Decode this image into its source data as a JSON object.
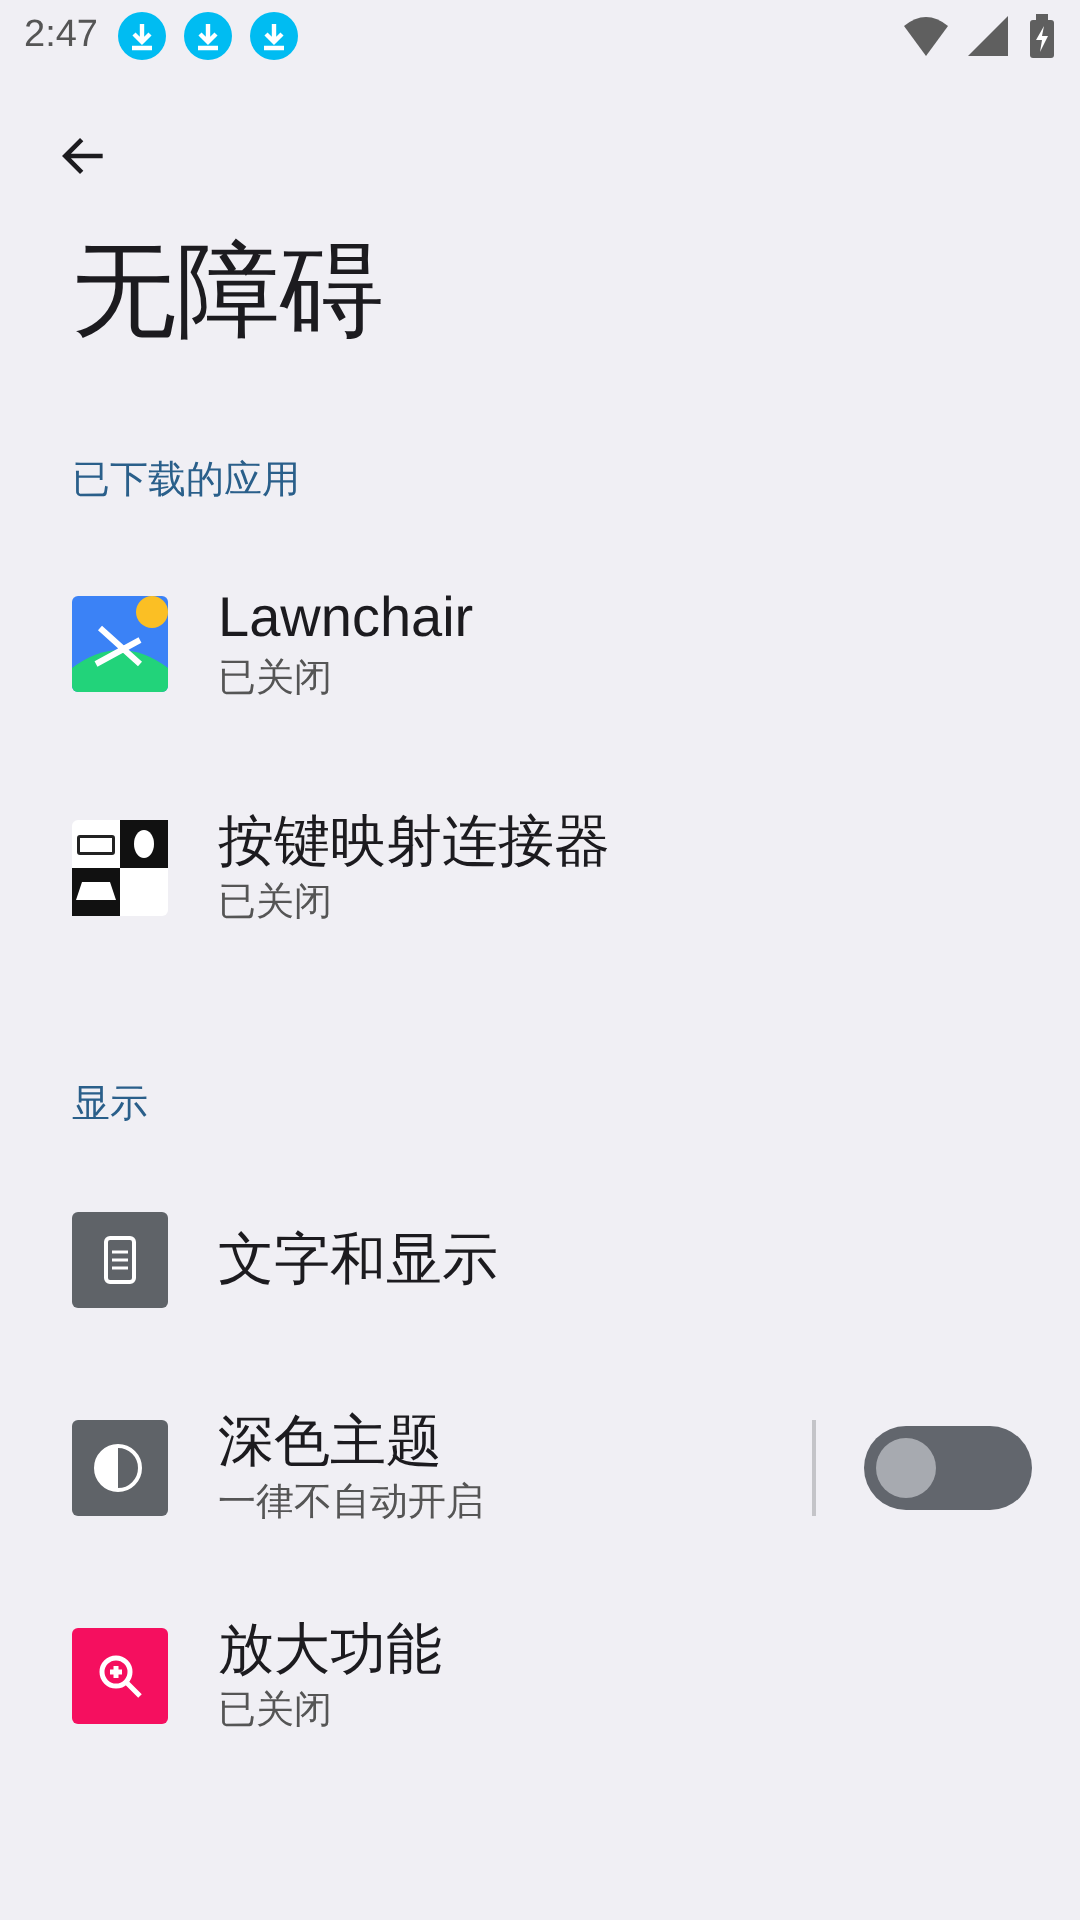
{
  "status_bar": {
    "time": "2:47",
    "notifications": [
      {
        "kind": "download"
      },
      {
        "kind": "download"
      },
      {
        "kind": "download"
      }
    ]
  },
  "title": "无障碍",
  "sections": [
    {
      "title": "已下载的应用",
      "items": [
        {
          "title": "Lawnchair",
          "subtitle": "已关闭",
          "kind": "plain"
        },
        {
          "title": "按键映射连接器",
          "subtitle": "已关闭",
          "kind": "plain"
        }
      ]
    },
    {
      "title": "显示",
      "items": [
        {
          "title": "文字和显示",
          "kind": "plain"
        },
        {
          "title": "深色主题",
          "subtitle": "一律不自动开启",
          "kind": "switch",
          "on": false
        },
        {
          "title": "放大功能",
          "subtitle": "已关闭",
          "kind": "plain"
        }
      ]
    }
  ]
}
